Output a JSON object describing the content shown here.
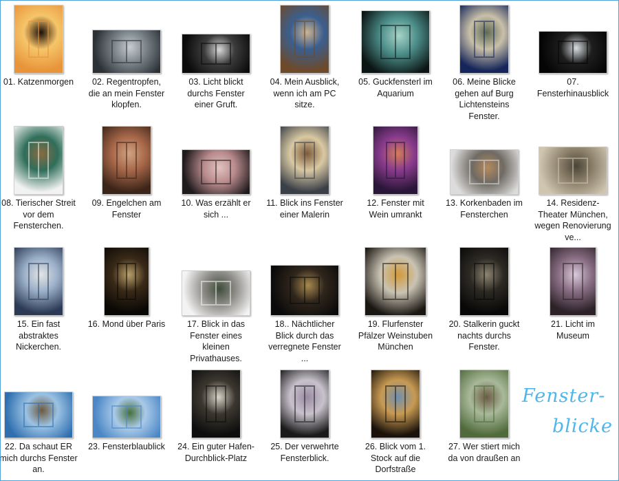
{
  "watermark": {
    "line1": "Fenster-",
    "line2": "blicke"
  },
  "items": [
    {
      "caption": "01. Katzenmorgen",
      "icon": "cat-at-sunrise-window-thumbnail",
      "colors": [
        "#e8943a",
        "#f6c56a",
        "#1c0f08"
      ]
    },
    {
      "caption": "02. Regentropfen, die an mein Fenster klopfen.",
      "icon": "raindrops-thumbnail",
      "colors": [
        "#2c3136",
        "#7d868d",
        "#c7ccd0"
      ]
    },
    {
      "caption": "03. Licht blickt durchs Fenster einer Gruft.",
      "icon": "crypt-window-thumbnail",
      "colors": [
        "#0b0b0b",
        "#3c3c3c",
        "#d9d9d9"
      ]
    },
    {
      "caption": "04. Mein Ausblick, wenn ich am PC sitze.",
      "icon": "window-view-thumbnail",
      "colors": [
        "#6d4a2a",
        "#3a5f8f",
        "#cdb390"
      ]
    },
    {
      "caption": "05. Guckfensterl im Aquarium",
      "icon": "aquarium-porthole-thumbnail",
      "colors": [
        "#0b1514",
        "#4d8f8b",
        "#a8d4c7"
      ]
    },
    {
      "caption": "06. Meine Blicke gehen auf Burg Lichtensteins Fenster.",
      "icon": "castle-tower-thumbnail",
      "colors": [
        "#16265a",
        "#c9c0a8",
        "#5e6a55"
      ]
    },
    {
      "caption": "07. Fensterhinausblick",
      "icon": "arched-window-thumbnail",
      "colors": [
        "#050505",
        "#1e1e1e",
        "#d8dde0"
      ]
    },
    {
      "caption": "08. Tierischer Streit vor dem Fensterchen.",
      "icon": "niche-birds-thumbnail",
      "colors": [
        "#f2f2f2",
        "#2f6e5a",
        "#8a6a3e"
      ]
    },
    {
      "caption": "09. Engelchen am Fenster",
      "icon": "angel-window-thumbnail",
      "colors": [
        "#3b2418",
        "#a8684a",
        "#d0a382"
      ]
    },
    {
      "caption": "10. Was erzählt er sich ...",
      "icon": "cafe-window-thumbnail",
      "colors": [
        "#1f1a1c",
        "#b88a8c",
        "#e2c3bf"
      ]
    },
    {
      "caption": "11. Blick ins Fenster einer Malerin",
      "icon": "painter-window-thumbnail",
      "colors": [
        "#3a3f48",
        "#d9c9a3",
        "#7e5a3a"
      ]
    },
    {
      "caption": "12. Fenster mit Wein umrankt",
      "icon": "vine-window-thumbnail",
      "colors": [
        "#2a1638",
        "#8a3c8e",
        "#d57d57"
      ]
    },
    {
      "caption": "13. Korkenbaden im Fensterchen",
      "icon": "corks-window-thumbnail",
      "colors": [
        "#dcdcdc",
        "#6f6a63",
        "#b58a5c"
      ]
    },
    {
      "caption": "14. Residenz-Theater München, wegen Renovierung ve...",
      "icon": "theater-facade-thumbnail",
      "colors": [
        "#cfc5b1",
        "#8b7f69",
        "#4a4438"
      ]
    },
    {
      "caption": "15. Ein fast abstraktes Nickerchen.",
      "icon": "nap-window-thumbnail",
      "colors": [
        "#2d3a55",
        "#9ab0c8",
        "#e4e4e4"
      ]
    },
    {
      "caption": "16. Mond über Paris",
      "icon": "moon-window-thumbnail",
      "colors": [
        "#0a0805",
        "#3a2a18",
        "#b9a06a"
      ]
    },
    {
      "caption": "17. Blick in das Fenster eines kleinen Privathauses.",
      "icon": "shop-window-thumbnail",
      "colors": [
        "#f3f3f3",
        "#8c8a86",
        "#3e4c3a"
      ]
    },
    {
      "caption": "18.. Nächtlicher Blick durch das verregnete Fenster ...",
      "icon": "night-rain-thumbnail",
      "colors": [
        "#0a0a0a",
        "#30261c",
        "#a88a4e"
      ]
    },
    {
      "caption": "19. Flurfenster Pfälzer Weinstuben München",
      "icon": "round-window-thumbnail",
      "colors": [
        "#1a1612",
        "#c9c3b3",
        "#d39a3a"
      ]
    },
    {
      "caption": "20. Stalkerin guckt nachts durchs Fenster.",
      "icon": "cat-night-window-thumbnail",
      "colors": [
        "#080808",
        "#2d2a24",
        "#8d8570"
      ]
    },
    {
      "caption": "21. Licht im Museum",
      "icon": "museum-light-thumbnail",
      "colors": [
        "#2c2228",
        "#8a6f85",
        "#d8c9d8"
      ]
    },
    {
      "caption": "22. Da schaut ER mich durchs Fenster an.",
      "icon": "moth-window-thumbnail",
      "colors": [
        "#2f6fb0",
        "#9bc2e3",
        "#6e5a3d"
      ]
    },
    {
      "caption": "23. Fensterblaublick",
      "icon": "blue-sky-window-thumbnail",
      "colors": [
        "#4b87c6",
        "#a9c9e8",
        "#47703c"
      ]
    },
    {
      "caption": "24. Ein guter Hafen-Durchblick-Platz",
      "icon": "harbor-window-thumbnail",
      "colors": [
        "#0d0d0d",
        "#3c3830",
        "#d9d4c8"
      ]
    },
    {
      "caption": "25. Der verwehrte Fensterblick.",
      "icon": "curtain-window-thumbnail",
      "colors": [
        "#1a1a1a",
        "#c8c2cc",
        "#9a8aa3"
      ]
    },
    {
      "caption": "26. Blick vom 1. Stock auf die Dorfstraße",
      "icon": "arched-view-thumbnail",
      "colors": [
        "#1a120b",
        "#c89a52",
        "#6f8fb0"
      ]
    },
    {
      "caption": "27. Wer stiert mich da von draußen an",
      "icon": "bird-window-thumbnail",
      "colors": [
        "#506a3b",
        "#a8b99a",
        "#6d5a44"
      ]
    }
  ]
}
